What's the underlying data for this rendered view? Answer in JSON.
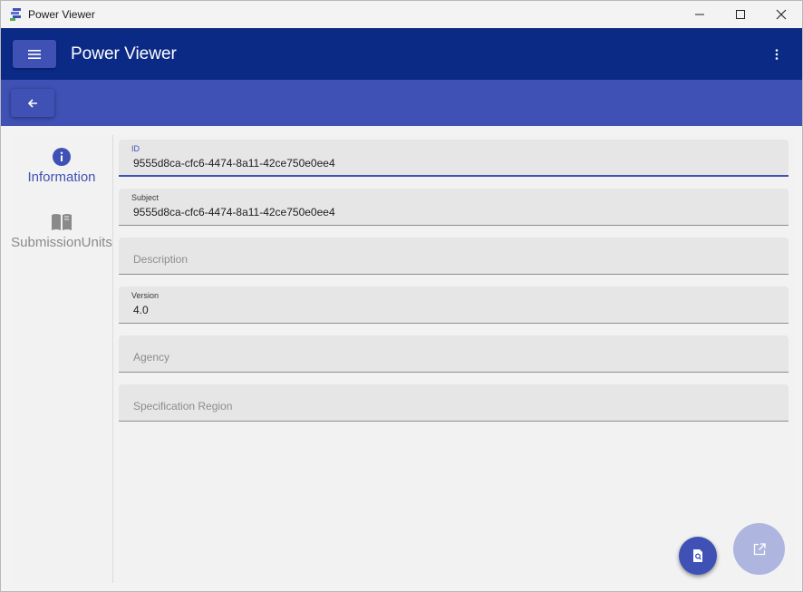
{
  "window": {
    "title": "Power Viewer"
  },
  "appbar": {
    "title": "Power Viewer",
    "icons": {
      "menu": "hamburger-icon",
      "more": "kebab-icon",
      "back": "arrow-left-icon"
    }
  },
  "sidenav": {
    "items": [
      {
        "label": "Information",
        "icon": "info-icon",
        "selected": true
      },
      {
        "label": "SubmissionUnits",
        "icon": "book-icon",
        "selected": false
      }
    ]
  },
  "form": {
    "fields": [
      {
        "label": "ID",
        "value": "9555d8ca-cfc6-4474-8a11-42ce750e0ee4",
        "placeholder": ""
      },
      {
        "label": "Subject",
        "value": "9555d8ca-cfc6-4474-8a11-42ce750e0ee4",
        "placeholder": ""
      },
      {
        "label": "",
        "value": "",
        "placeholder": "Description"
      },
      {
        "label": "Version",
        "value": "4.0",
        "placeholder": ""
      },
      {
        "label": "",
        "value": "",
        "placeholder": "Agency"
      },
      {
        "label": "",
        "value": "",
        "placeholder": "Specification Region"
      }
    ]
  },
  "fabs": {
    "search": "document-search-icon",
    "open": "open-external-icon"
  },
  "colors": {
    "appbar": "#0b2a86",
    "accent": "#3f51b5",
    "fab_disabled": "#aeb6e0"
  }
}
